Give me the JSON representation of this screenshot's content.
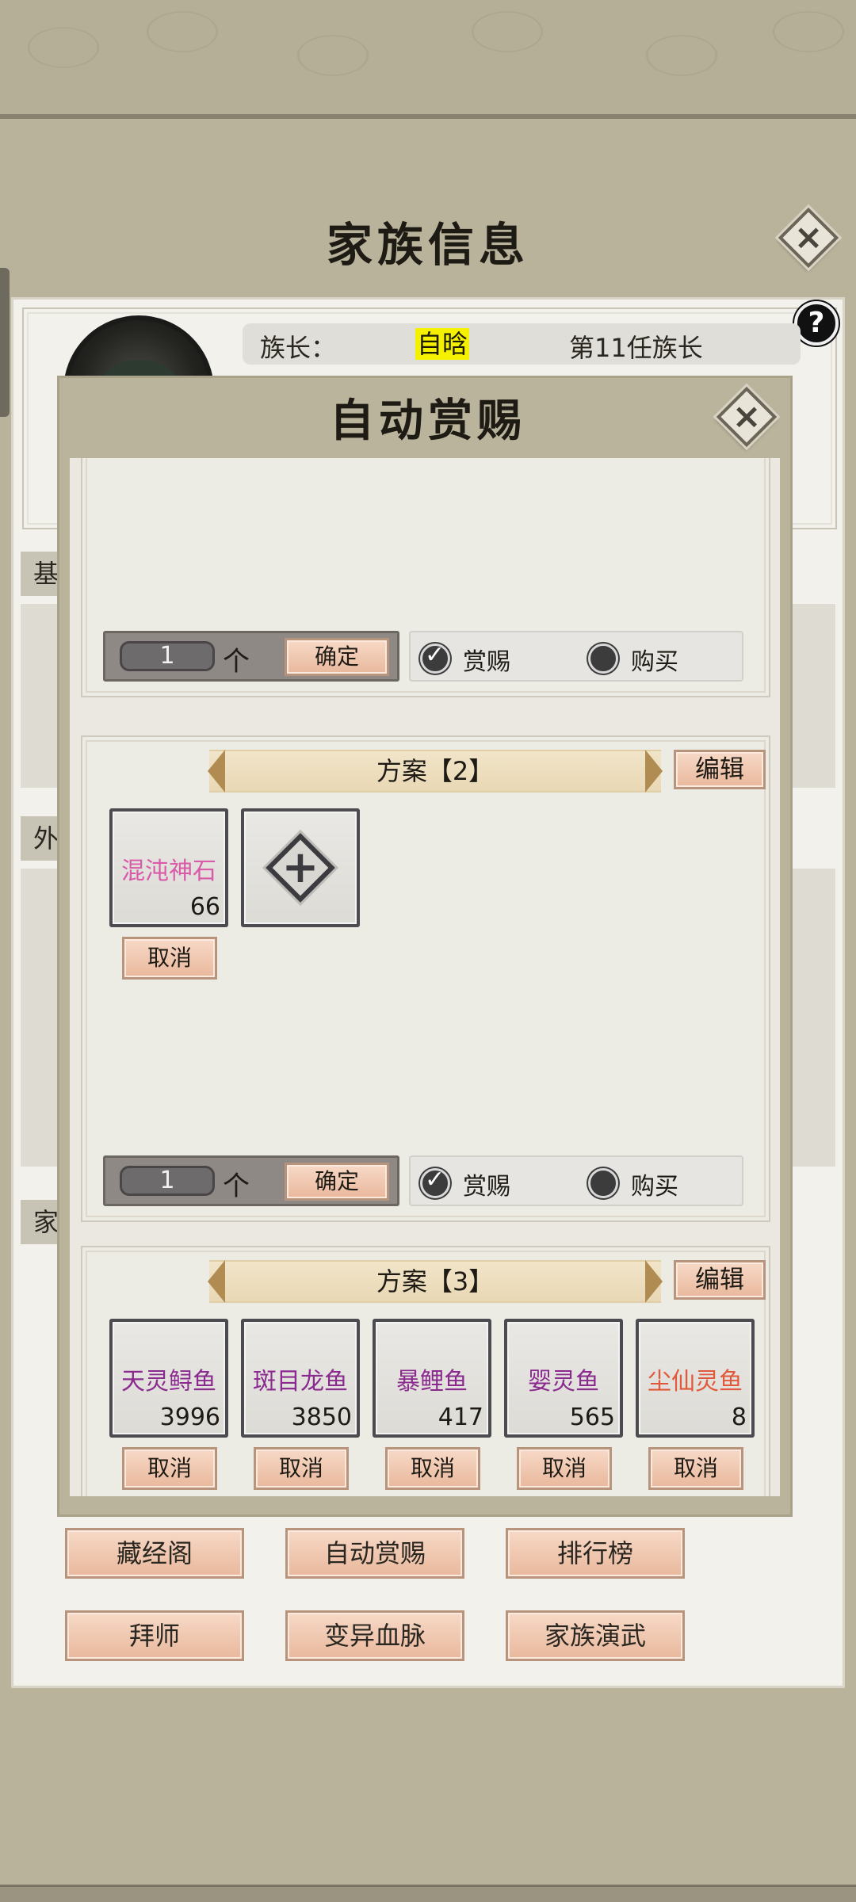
{
  "main": {
    "title": "家族信息",
    "help_label": "?",
    "leader": {
      "label": "族长：",
      "name": "自晗",
      "rank": "第11任族长"
    },
    "side_tabs": [
      "基",
      "外",
      "家"
    ],
    "buttons": [
      "藏经阁",
      "自动赏赐",
      "排行榜",
      "拜师",
      "变异血脉",
      "家族演武"
    ]
  },
  "modal": {
    "title": "自动赏赐",
    "close_icon": "×",
    "plans": [
      {
        "quantity": "1",
        "unit": "个",
        "confirm_label": "确定",
        "options": [
          {
            "label": "赏赐",
            "selected": true
          },
          {
            "label": "购买",
            "selected": false
          }
        ]
      },
      {
        "header": "方案【2】",
        "edit_label": "编辑",
        "items": [
          {
            "name": "混沌神石",
            "count": "66",
            "color": "#d95aa8"
          }
        ],
        "add_icon": "+",
        "cancel_label": "取消",
        "quantity": "1",
        "unit": "个",
        "confirm_label": "确定",
        "options": [
          {
            "label": "赏赐",
            "selected": true
          },
          {
            "label": "购买",
            "selected": false
          }
        ]
      },
      {
        "header": "方案【3】",
        "edit_label": "编辑",
        "items": [
          {
            "name": "天灵鲟鱼",
            "count": "3996",
            "color": "#8a2a8e"
          },
          {
            "name": "斑目龙鱼",
            "count": "3850",
            "color": "#8a2a8e"
          },
          {
            "name": "暴鲤鱼",
            "count": "417",
            "color": "#8a2a8e"
          },
          {
            "name": "婴灵鱼",
            "count": "565",
            "color": "#8a2a8e"
          },
          {
            "name": "尘仙灵鱼",
            "count": "8",
            "color": "#e2583a"
          }
        ],
        "cancel_label": "取消"
      }
    ]
  },
  "colors": {
    "accent_button": "#e9b89c",
    "backdrop": "#bab39c"
  }
}
